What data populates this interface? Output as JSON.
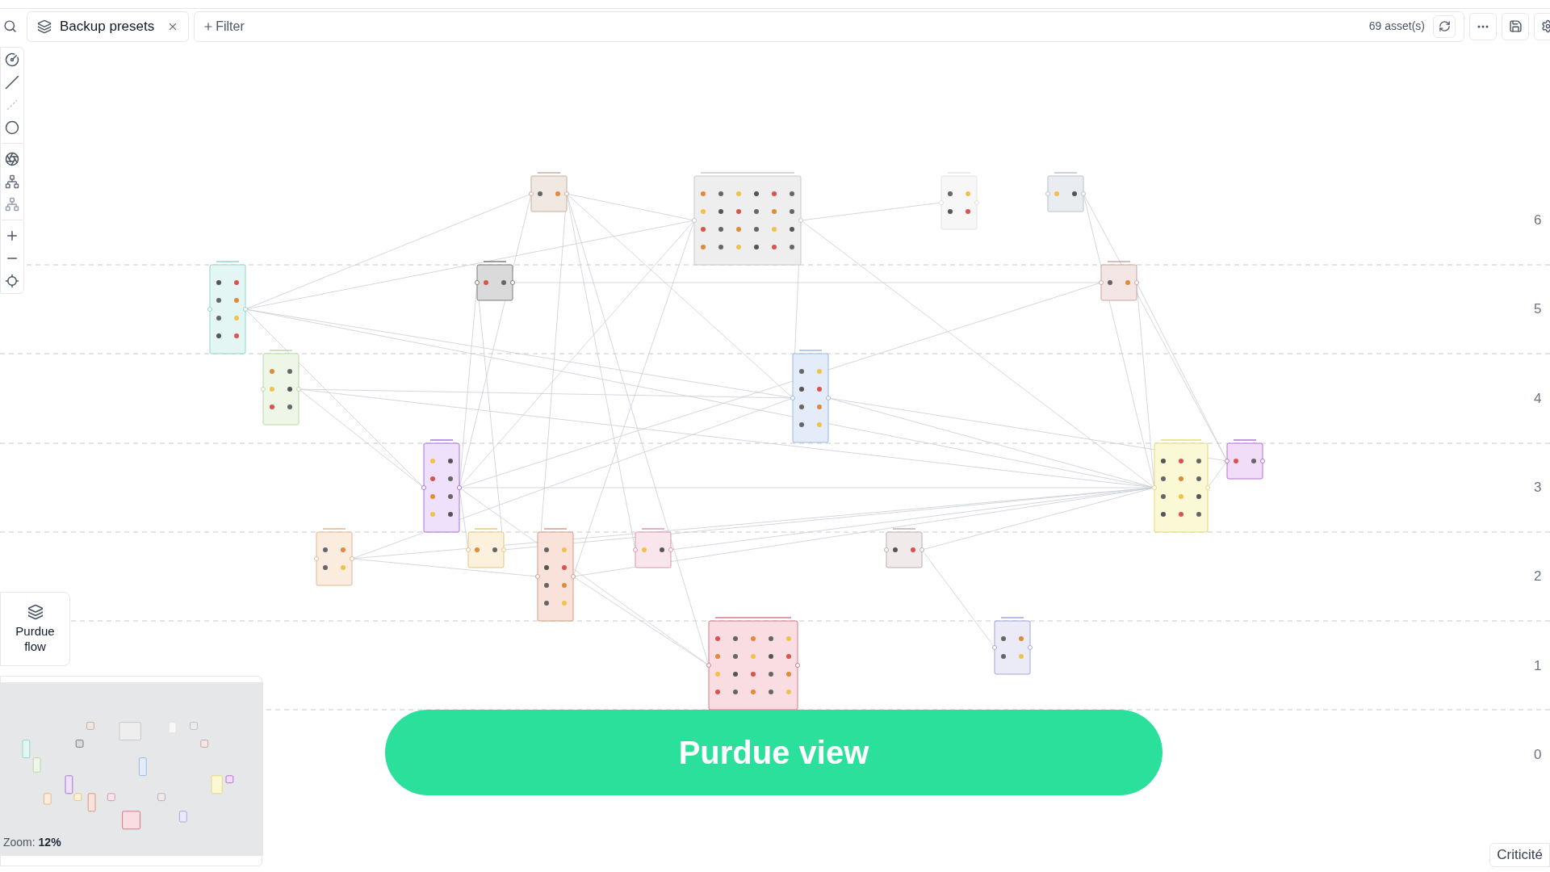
{
  "toolbar": {
    "tab": {
      "label": "Backup presets"
    },
    "filter": {
      "label": "Filter"
    },
    "asset_count": "69 asset(s)"
  },
  "purdue_levels": [
    "6",
    "5",
    "4",
    "3",
    "2",
    "1",
    "0"
  ],
  "purdue_flow_button": {
    "label": "Purdue flow"
  },
  "minimap": {
    "zoom_label": "Zoom:",
    "zoom_value": "12%"
  },
  "banner": {
    "text": "Purdue view"
  },
  "legend_button": {
    "label": "Criticité"
  }
}
